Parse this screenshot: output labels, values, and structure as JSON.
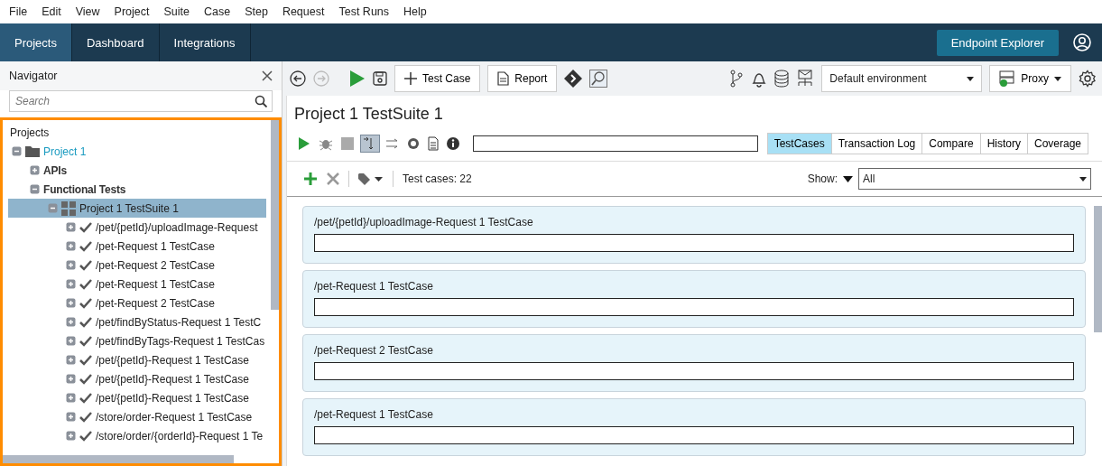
{
  "menu": [
    "File",
    "Edit",
    "View",
    "Project",
    "Suite",
    "Case",
    "Step",
    "Request",
    "Test Runs",
    "Help"
  ],
  "nav_tabs": [
    {
      "label": "Projects",
      "selected": true
    },
    {
      "label": "Dashboard",
      "selected": false
    },
    {
      "label": "Integrations",
      "selected": false
    }
  ],
  "endpoint_button": "Endpoint Explorer",
  "navigator": {
    "title": "Navigator",
    "search": {
      "placeholder": "Search"
    },
    "root_label": "Projects",
    "tree": [
      {
        "label": "Project 1",
        "kind": "project",
        "expanded": true,
        "selected": false,
        "children": [
          {
            "label": "APIs",
            "kind": "folder",
            "expanded": false,
            "selected": false
          },
          {
            "label": "Functional Tests",
            "kind": "folder",
            "expanded": true,
            "selected": false,
            "children": [
              {
                "label": "Project 1 TestSuite 1",
                "kind": "suite",
                "expanded": true,
                "selected": true,
                "children": [
                  {
                    "label": "/pet/{petId}/uploadImage-Request",
                    "kind": "case",
                    "expanded": false,
                    "selected": false
                  },
                  {
                    "label": "/pet-Request 1 TestCase",
                    "kind": "case",
                    "expanded": false,
                    "selected": false
                  },
                  {
                    "label": "/pet-Request 2 TestCase",
                    "kind": "case",
                    "expanded": false,
                    "selected": false
                  },
                  {
                    "label": "/pet-Request 1 TestCase",
                    "kind": "case",
                    "expanded": false,
                    "selected": false
                  },
                  {
                    "label": "/pet-Request 2 TestCase",
                    "kind": "case",
                    "expanded": false,
                    "selected": false
                  },
                  {
                    "label": "/pet/findByStatus-Request 1 TestC",
                    "kind": "case",
                    "expanded": false,
                    "selected": false
                  },
                  {
                    "label": "/pet/findByTags-Request 1 TestCas",
                    "kind": "case",
                    "expanded": false,
                    "selected": false
                  },
                  {
                    "label": "/pet/{petId}-Request 1 TestCase",
                    "kind": "case",
                    "expanded": false,
                    "selected": false
                  },
                  {
                    "label": "/pet/{petId}-Request 1 TestCase",
                    "kind": "case",
                    "expanded": false,
                    "selected": false
                  },
                  {
                    "label": "/pet/{petId}-Request 1 TestCase",
                    "kind": "case",
                    "expanded": false,
                    "selected": false
                  },
                  {
                    "label": "/store/order-Request 1 TestCase",
                    "kind": "case",
                    "expanded": false,
                    "selected": false
                  },
                  {
                    "label": "/store/order/{orderId}-Request 1 Te",
                    "kind": "case",
                    "expanded": false,
                    "selected": false
                  }
                ]
              }
            ]
          }
        ]
      }
    ]
  },
  "toolbar": {
    "back_disabled": false,
    "forward_disabled": true,
    "test_case_button": "Test Case",
    "report_button": "Report",
    "environment": "Default environment",
    "proxy_button": "Proxy"
  },
  "suite": {
    "title": "Project 1 TestSuite 1",
    "run_tools": [
      {
        "kind": "run",
        "on": false
      },
      {
        "kind": "debug",
        "on": false
      },
      {
        "kind": "stop",
        "on": false
      },
      {
        "kind": "sequential",
        "on": true
      },
      {
        "kind": "parallel",
        "on": false
      },
      {
        "kind": "gauge",
        "on": false
      },
      {
        "kind": "document",
        "on": false
      },
      {
        "kind": "info",
        "on": false
      }
    ],
    "tabs": [
      {
        "label": "TestCases",
        "selected": true
      },
      {
        "label": "Transaction Log",
        "selected": false
      },
      {
        "label": "Compare",
        "selected": false
      },
      {
        "label": "History",
        "selected": false
      },
      {
        "label": "Coverage",
        "selected": false
      }
    ],
    "count": "Test cases: 22",
    "show_label": "Show:",
    "show_value": "All",
    "cases": [
      {
        "title": "/pet/{petId}/uploadImage-Request 1 TestCase"
      },
      {
        "title": "/pet-Request 1 TestCase"
      },
      {
        "title": "/pet-Request 2 TestCase"
      },
      {
        "title": "/pet-Request 1 TestCase"
      }
    ]
  }
}
